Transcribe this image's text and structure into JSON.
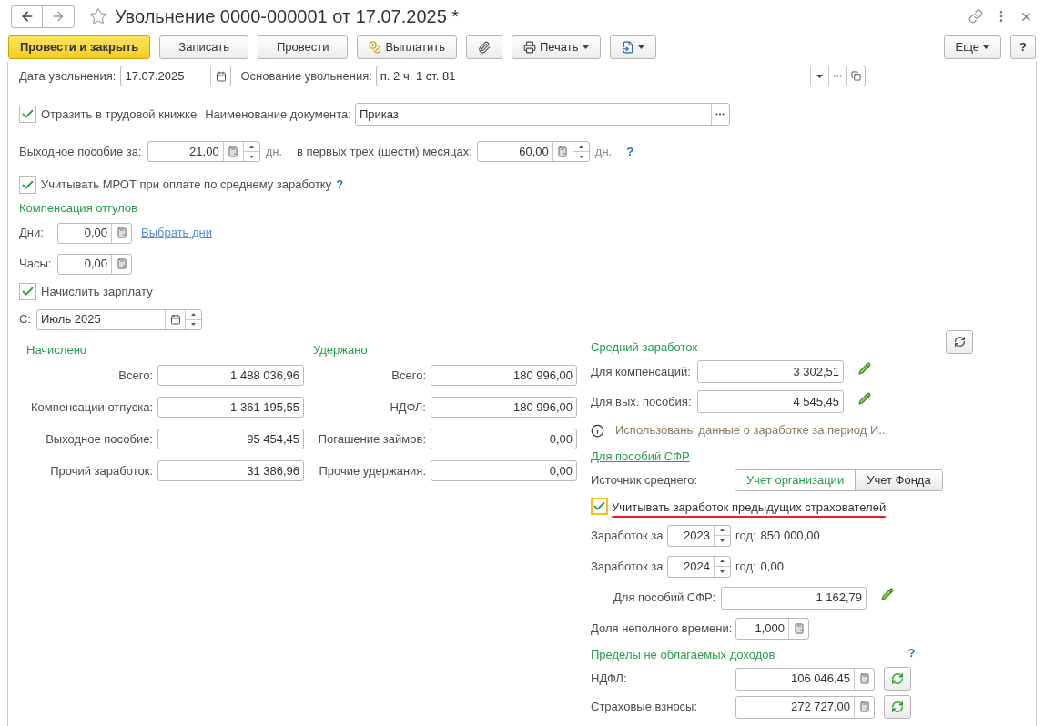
{
  "window": {
    "title": "Увольнение 0000-000001 от 17.07.2025 *",
    "favorite": false
  },
  "toolbar": {
    "buttons": [
      {
        "kind": "primary",
        "label": "Провести и закрыть"
      },
      {
        "kind": "plain",
        "label": "Записать"
      },
      {
        "kind": "plain",
        "label": "Провести"
      },
      {
        "kind": "pay",
        "label": "Выплатить"
      },
      {
        "kind": "attach"
      },
      {
        "kind": "print",
        "label": "Печать"
      },
      {
        "kind": "export"
      }
    ],
    "more": "Еще",
    "help": "?"
  },
  "dismissal_date": {
    "label": "Дата увольнения:",
    "value": "17.07.2025"
  },
  "basis": {
    "label": "Основание увольнения:",
    "value": "п. 2 ч. 1 ст. 81"
  },
  "work_book": {
    "label": "Отразить в трудовой книжке",
    "checked": true
  },
  "document_name": {
    "label": "Наименование документа:",
    "value": "Приказ"
  },
  "severance": {
    "label": "Выходное пособие за:",
    "value": "21,00",
    "unit": "дн.",
    "label2": "в первых трех (шести) месяцах:",
    "value2": "60,00",
    "unit2": "дн.",
    "help": "?"
  },
  "mrot": {
    "label": "Учитывать МРОТ при оплате по среднему заработку",
    "checked": true,
    "help": "?"
  },
  "time_off": {
    "title": "Компенсация отгулов",
    "days_label": "Дни:",
    "days": "0,00",
    "link": "Выбрать дни",
    "hours_label": "Часы:",
    "hours": "0,00"
  },
  "accrue_salary": {
    "label": "Начислить зарплату",
    "checked": true
  },
  "from": {
    "label": "С:",
    "value": "Июль 2025"
  },
  "accrued": {
    "title": "Начислено",
    "rows": [
      {
        "label": "Всего:",
        "value": "1 488 036,96"
      },
      {
        "label": "Компенсации отпуска:",
        "value": "1 361 195,55"
      },
      {
        "label": "Выходное пособие:",
        "value": "95 454,45"
      },
      {
        "label": "Прочий заработок:",
        "value": "31 386,96"
      }
    ]
  },
  "withheld": {
    "title": "Удержано",
    "rows": [
      {
        "label": "Всего:",
        "value": "180 996,00"
      },
      {
        "label": "НДФЛ:",
        "value": "180 996,00"
      },
      {
        "label": "Погашение займов:",
        "value": "0,00"
      },
      {
        "label": "Прочие удержания:",
        "value": "0,00"
      }
    ]
  },
  "average": {
    "title": "Средний заработок",
    "rows": [
      {
        "label": "Для компенсаций:",
        "value": "3 302,51"
      },
      {
        "label": "Для вых. пособия:",
        "value": "4 545,45"
      }
    ],
    "info": "Использованы данные о заработке за период И...",
    "sfr_link": "Для пособий СФР",
    "source_label": "Источник среднего:",
    "source_options": [
      {
        "label": "Учет организации",
        "selected": true
      },
      {
        "label": "Учет Фонда",
        "selected": false
      }
    ],
    "prev_insurers": {
      "label": "Учитывать заработок предыдущих страхователей",
      "checked": true,
      "focused": true
    },
    "years": [
      {
        "label": "Заработок за",
        "year": "2023",
        "suffix": "год:",
        "amount": "850 000,00"
      },
      {
        "label": "Заработок за",
        "year": "2024",
        "suffix": "год:",
        "amount": "0,00"
      }
    ],
    "sfr": {
      "label": "Для пособий СФР:",
      "value": "1 162,79"
    },
    "part_time": {
      "label": "Доля неполного времени:",
      "value": "1,000"
    }
  },
  "limits": {
    "title": "Пределы не облагаемых доходов",
    "help": "?",
    "rows": [
      {
        "label": "НДФЛ:",
        "value": "106 046,45"
      },
      {
        "label": "Страховые взносы:",
        "value": "272 727,00"
      }
    ]
  }
}
